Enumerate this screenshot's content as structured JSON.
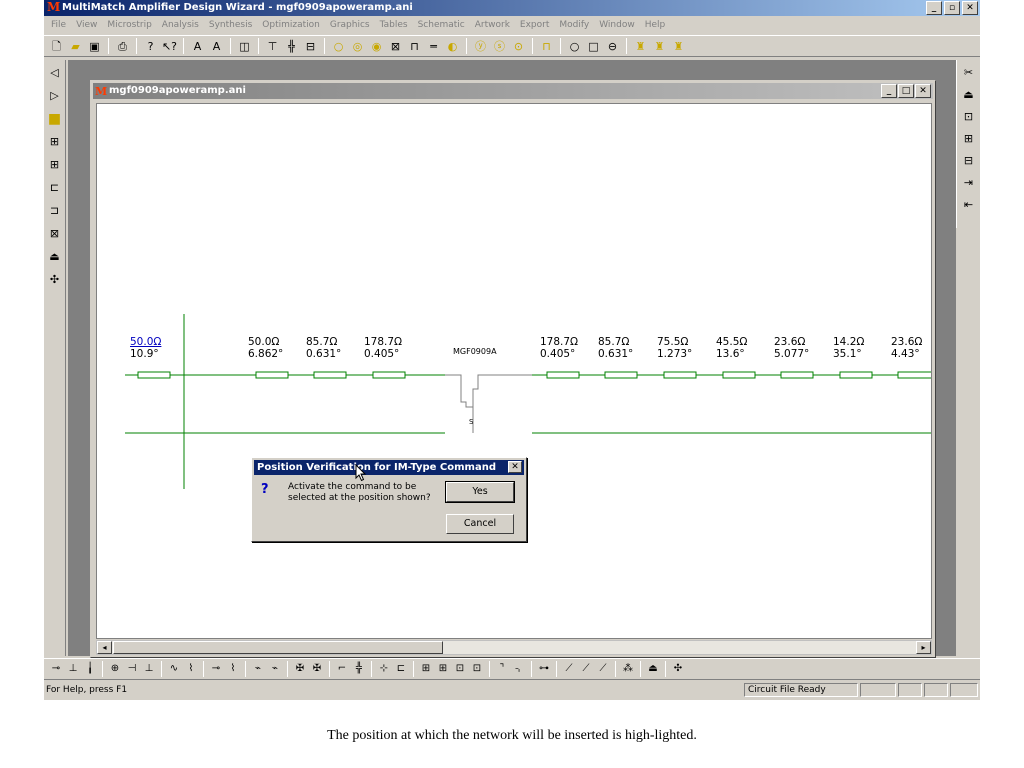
{
  "app": {
    "title": "MultiMatch Amplifier Design Wizard - mgf0909apoweramp.ani",
    "logo": "M",
    "minimize": "_",
    "maximize": "▫",
    "close": "✕"
  },
  "menu": [
    "File",
    "View",
    "Microstrip",
    "Analysis",
    "Synthesis",
    "Optimization",
    "Graphics",
    "Tables",
    "Schematic",
    "Artwork",
    "Export",
    "Modify",
    "Window",
    "Help"
  ],
  "child_window": {
    "title": "mgf0909apoweramp.ani",
    "logo": "M",
    "minimize": "_",
    "maximize": "□",
    "close": "✕"
  },
  "schematic": {
    "input_line": {
      "impedance": "50.0Ω",
      "angle": "10.9°"
    },
    "left_lines": [
      {
        "impedance": "50.0Ω",
        "angle": "6.862°"
      },
      {
        "impedance": "85.7Ω",
        "angle": "0.631°"
      },
      {
        "impedance": "178.7Ω",
        "angle": "0.405°"
      }
    ],
    "device": "MGF0909A",
    "source_label": "S",
    "right_lines": [
      {
        "impedance": "178.7Ω",
        "angle": "0.405°"
      },
      {
        "impedance": "85.7Ω",
        "angle": "0.631°"
      },
      {
        "impedance": "75.5Ω",
        "angle": "1.273°"
      },
      {
        "impedance": "45.5Ω",
        "angle": "13.6°"
      },
      {
        "impedance": "23.6Ω",
        "angle": "5.077°"
      },
      {
        "impedance": "14.2Ω",
        "angle": "35.1°"
      },
      {
        "impedance": "23.6Ω",
        "angle": "4.43°"
      }
    ]
  },
  "dialog": {
    "title": "Position Verification for IM-Type Command",
    "close": "✕",
    "icon": "question-icon",
    "icon_glyph": "?",
    "message": "Activate the command to be selected at the position shown?",
    "yes_label": "Yes",
    "cancel_label": "Cancel"
  },
  "status": {
    "help": "For Help, press F1",
    "state": "Circuit File Ready"
  },
  "scroll": {
    "left": "◂",
    "right": "▸"
  },
  "caption": "The position at which the network will be inserted is high-lighted.",
  "colors": {
    "title_active": "#0a246a",
    "title_inactive": "#808080",
    "face": "#d4d0c8",
    "line": "#008000",
    "stub": "#008000"
  }
}
